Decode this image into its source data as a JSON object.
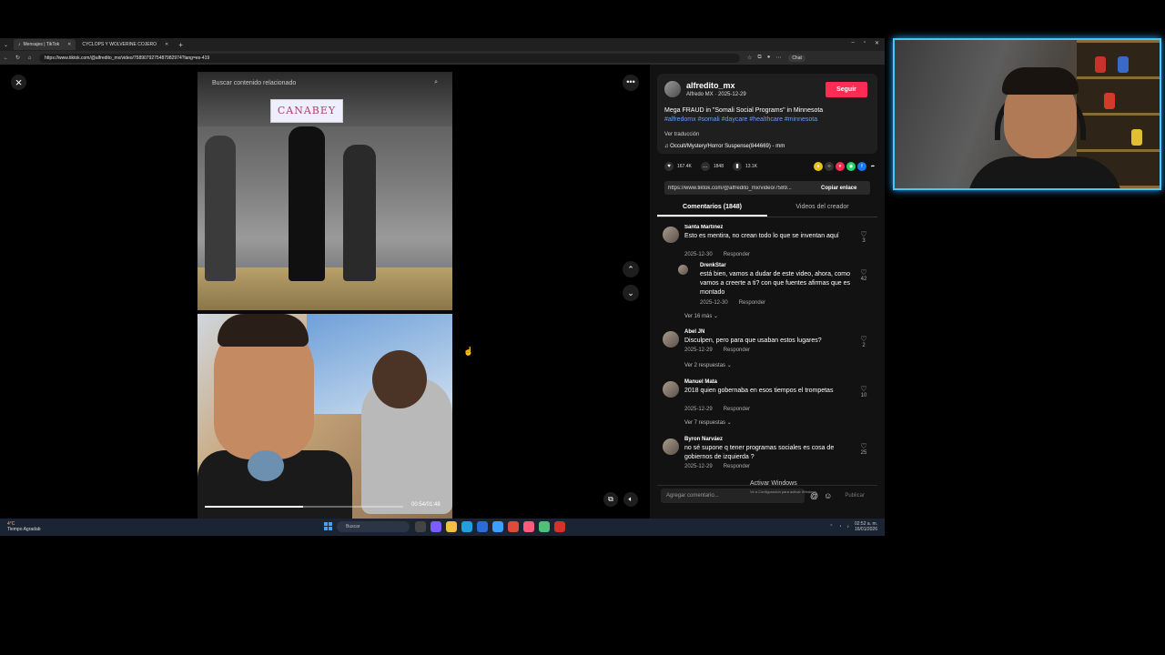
{
  "browser": {
    "tabs": [
      {
        "label": "Mensajes | TikTok",
        "active": true
      },
      {
        "label": "CYCLOPS Y WOLVERINE COJERO",
        "active": false
      }
    ],
    "url": "https://www.tiktok.com/@alfredito_mx/video/7589079275487982974?lang=es-419",
    "chat_label": "Chat"
  },
  "video": {
    "search_placeholder": "Buscar contenido relacionado",
    "sign_text": "CANABEY",
    "progress": 0.495,
    "timecode": "00:54/01:48"
  },
  "post": {
    "username": "alfredito_mx",
    "display_name": "Alfredo MX",
    "date": "2025-12-29",
    "follow_label": "Seguir",
    "description": "Mega FRAUD in \"Somali Social Programs\" in Minnesota",
    "hashtags": "#alfredomx #somali #daycare #healthcare #minnesota",
    "translate_label": "Ver traducción",
    "music": "Occult/Mystery/Horror Suspense(844669) - mm"
  },
  "stats": {
    "likes": "167.4K",
    "comments": "1848",
    "saves": "13.1K"
  },
  "share": {
    "link": "https://www.tiktok.com/@alfredito_mx/video/7589...",
    "copy_label": "Copiar enlace"
  },
  "panel_tabs": [
    {
      "label": "Comentarios (1848)",
      "active": true
    },
    {
      "label": "Videos del creador",
      "active": false
    }
  ],
  "reply_label": "Responder",
  "comments": [
    {
      "name": "Santa Martinez",
      "text": "Esto es mentira, no crean todo lo que se inventan aquí",
      "date": "2025-12-30",
      "likes": "3"
    },
    {
      "name": "DrenkStar",
      "text": "está bien, vamos a dudar de este video, ahora, como vamos a creerte a ti? con que fuentes afirmas que es montado",
      "date": "2025-12-30",
      "likes": "42"
    },
    {
      "name": "Abel JN",
      "text": "Disculpen, pero para que usaban estos lugares?",
      "date": "2025-12-29",
      "likes": "2"
    },
    {
      "name": "Manuel Mata",
      "text": "2018 quien gobernaba en esos tiempos el trompetas",
      "date": "2025-12-29",
      "likes": "10"
    },
    {
      "name": "Byron Narváez",
      "text": "no sé supone q tener programas sociales es cosa de gobiernos de izquierda ?",
      "date": "2025-12-29",
      "likes": "25"
    }
  ],
  "more_replies": [
    "Ver 16 más",
    "Ver 2 respuestas",
    "Ver 7 respuestas"
  ],
  "composer": {
    "placeholder": "Agregar comentario...",
    "publish_label": "Publicar"
  },
  "windows": {
    "activate_title": "Activar Windows",
    "activate_sub": "Ve a Configuración para activar Windows.",
    "weather_temp": "4°C",
    "weather_desc": "Tiempo Agradab",
    "search_label": "Buscar",
    "time": "02:52 a. m.",
    "date": "16/01/2026"
  },
  "colors": {
    "follow": "#fe2c55",
    "hashtag": "#6b9cff",
    "webcam_border": "#49c6ff"
  }
}
